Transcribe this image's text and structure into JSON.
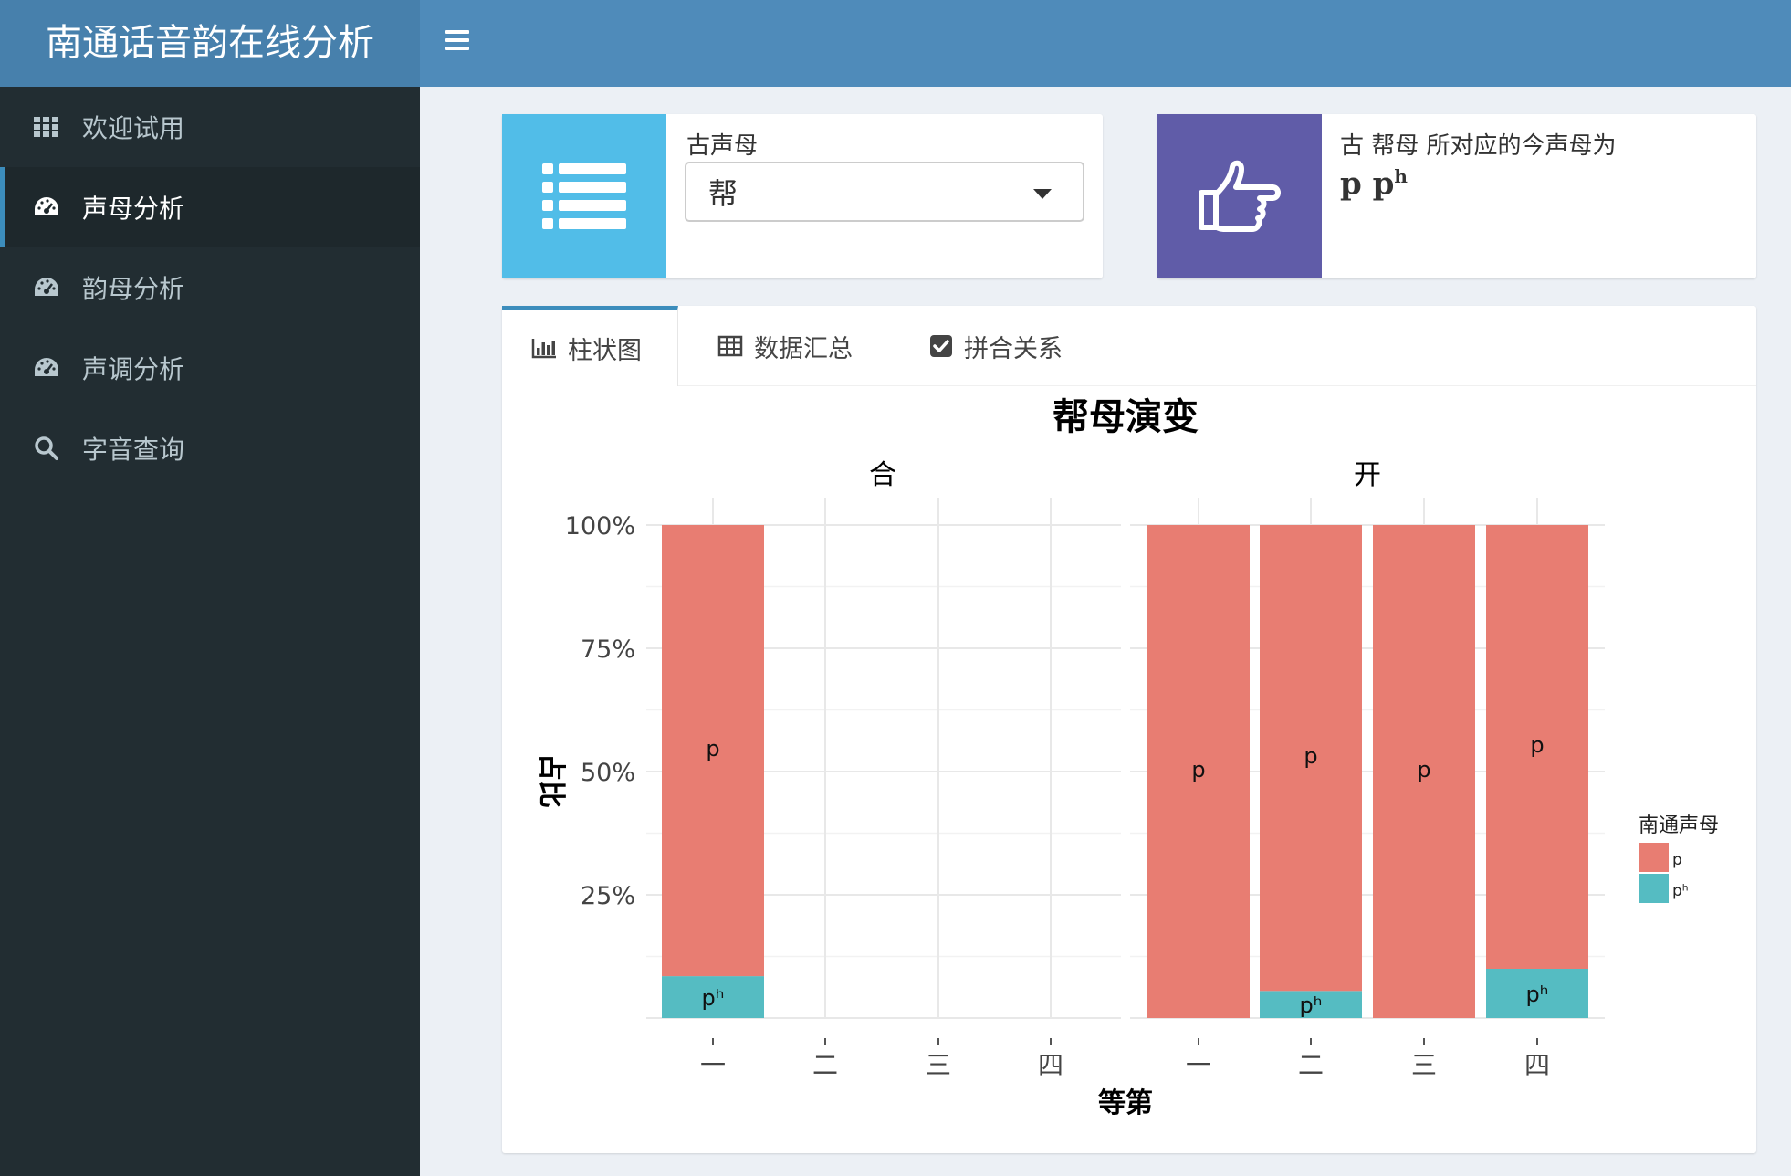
{
  "header": {
    "app_title": "南通话音韵在线分析"
  },
  "sidebar": {
    "items": [
      {
        "label": "欢迎试用",
        "icon": "grid-icon"
      },
      {
        "label": "声母分析",
        "icon": "dashboard-icon"
      },
      {
        "label": "韵母分析",
        "icon": "dashboard-icon"
      },
      {
        "label": "声调分析",
        "icon": "dashboard-icon"
      },
      {
        "label": "字音查询",
        "icon": "search-icon"
      }
    ],
    "active_index": 1
  },
  "initial_select": {
    "label": "古声母",
    "value": "帮",
    "icon": "list-icon",
    "color": "#51bde8"
  },
  "info_box": {
    "text": "古 帮母 所对应的今声母为",
    "value_base": "p p",
    "value_sup": "h",
    "icon": "hand-point-right-icon",
    "color": "#605ca8"
  },
  "tabs": [
    {
      "label": "柱状图",
      "icon": "bar-chart-icon"
    },
    {
      "label": "数据汇总",
      "icon": "table-icon"
    },
    {
      "label": "拼合关系",
      "icon": "check-square-icon"
    }
  ],
  "chart_data": {
    "type": "bar",
    "title": "帮母演变",
    "xlabel": "等第",
    "ylabel": "占比",
    "y_ticks": [
      "25%",
      "50%",
      "75%",
      "100%"
    ],
    "ylim": [
      0,
      1
    ],
    "categories": [
      "一",
      "二",
      "三",
      "四"
    ],
    "legend": {
      "title": "南通声母",
      "entries": [
        {
          "name": "p",
          "color": "#e87d72"
        },
        {
          "name": "pʰ",
          "color": "#55bcc2"
        }
      ]
    },
    "panels": [
      {
        "facet": "合",
        "series": [
          {
            "name": "p",
            "values": [
              0.915,
              null,
              null,
              null
            ]
          },
          {
            "name": "pʰ",
            "values": [
              0.085,
              null,
              null,
              null
            ]
          }
        ]
      },
      {
        "facet": "开",
        "series": [
          {
            "name": "p",
            "values": [
              1.0,
              0.945,
              1.0,
              0.9
            ]
          },
          {
            "name": "pʰ",
            "values": [
              0.0,
              0.055,
              0.0,
              0.1
            ]
          }
        ]
      }
    ]
  }
}
